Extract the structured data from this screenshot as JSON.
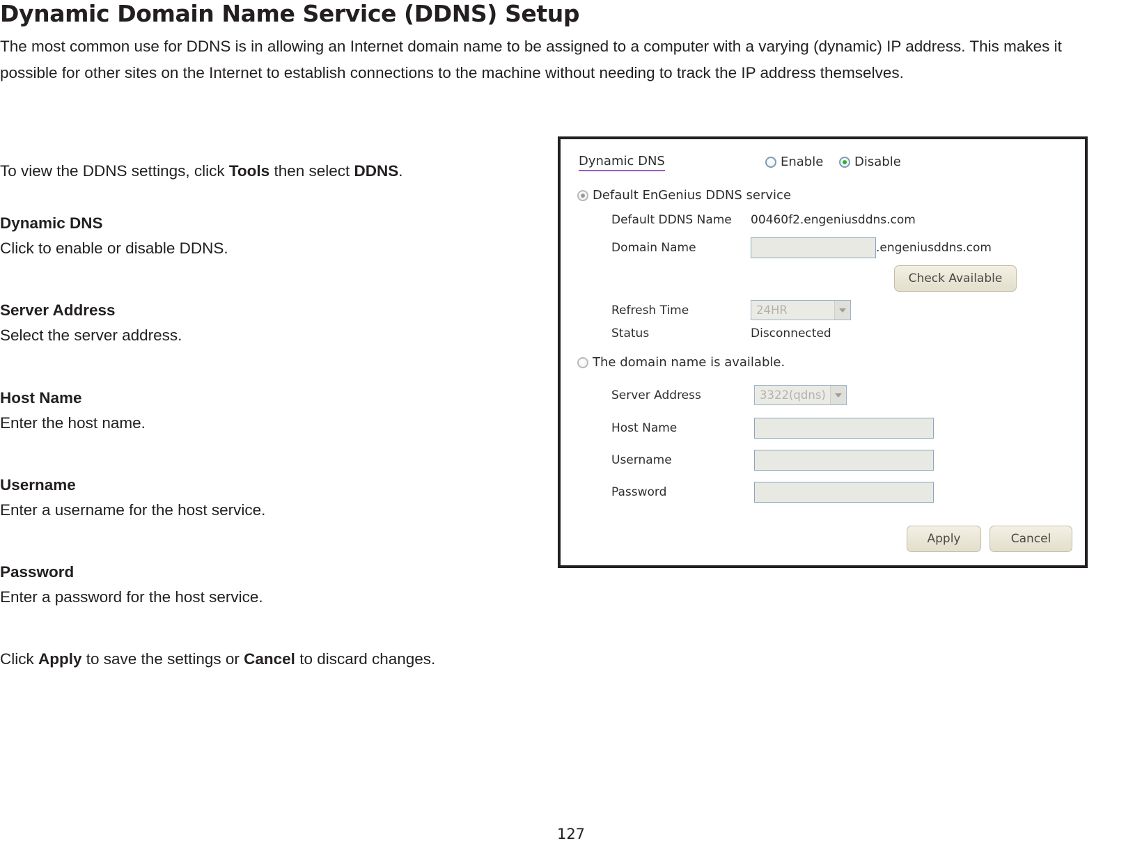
{
  "document": {
    "title": "Dynamic Domain Name Service (DDNS) Setup",
    "intro": "The most common use for DDNS is in allowing an Internet domain name to be assigned to a computer with a varying (dynamic) IP address. This makes it possible for other sites on the Internet to establish connections to the machine without needing to track the IP address themselves.",
    "page_number": "127",
    "instruction": {
      "lead": "To view the DDNS settings, click ",
      "bold1": "Tools",
      "middle": " then select ",
      "bold2": "DDNS",
      "tail": "."
    },
    "sections": [
      {
        "heading": "Dynamic DNS",
        "text": "Click to enable or disable DDNS."
      },
      {
        "heading": "Server Address",
        "text": "Select the server address."
      },
      {
        "heading": "Host Name",
        "text": "Enter the host name."
      },
      {
        "heading": "Username",
        "text": "Enter a username for the host service."
      },
      {
        "heading": "Password",
        "text": "Enter a password for the host service."
      }
    ],
    "closing": {
      "lead": "Click ",
      "bold1": "Apply",
      "middle": " to save the settings or ",
      "bold2": "Cancel",
      "tail": " to discard changes."
    }
  },
  "ui_panel": {
    "heading": "Dynamic DNS",
    "toggle": {
      "enable_label": "Enable",
      "enable_selected": false,
      "disable_label": "Disable",
      "disable_selected": true
    },
    "default_service": {
      "radio_label": "Default EnGenius DDNS service",
      "selected": true,
      "default_ddns_name_label": "Default DDNS Name",
      "default_ddns_name_value": "00460f2.engeniusddns.com",
      "domain_name_label": "Domain Name",
      "domain_name_value": "",
      "domain_name_suffix": ".engeniusddns.com",
      "check_available_label": "Check Available",
      "refresh_time_label": "Refresh Time",
      "refresh_time_value": "24HR",
      "status_label": "Status",
      "status_value": "Disconnected"
    },
    "custom_service": {
      "radio_label": "The domain name is available.",
      "selected": false,
      "server_address_label": "Server Address",
      "server_address_value": "3322(qdns)",
      "host_name_label": "Host Name",
      "host_name_value": "",
      "username_label": "Username",
      "username_value": "",
      "password_label": "Password",
      "password_value": ""
    },
    "actions": {
      "apply_label": "Apply",
      "cancel_label": "Cancel"
    },
    "colors": {
      "heading_underline": "#9b59c4",
      "radio_selected_dot": "#2ab32a",
      "input_border": "#8aa6bf",
      "input_fill": "#e9e9e3",
      "button_fill": "#eae6d6",
      "panel_border": "#231f20"
    }
  }
}
